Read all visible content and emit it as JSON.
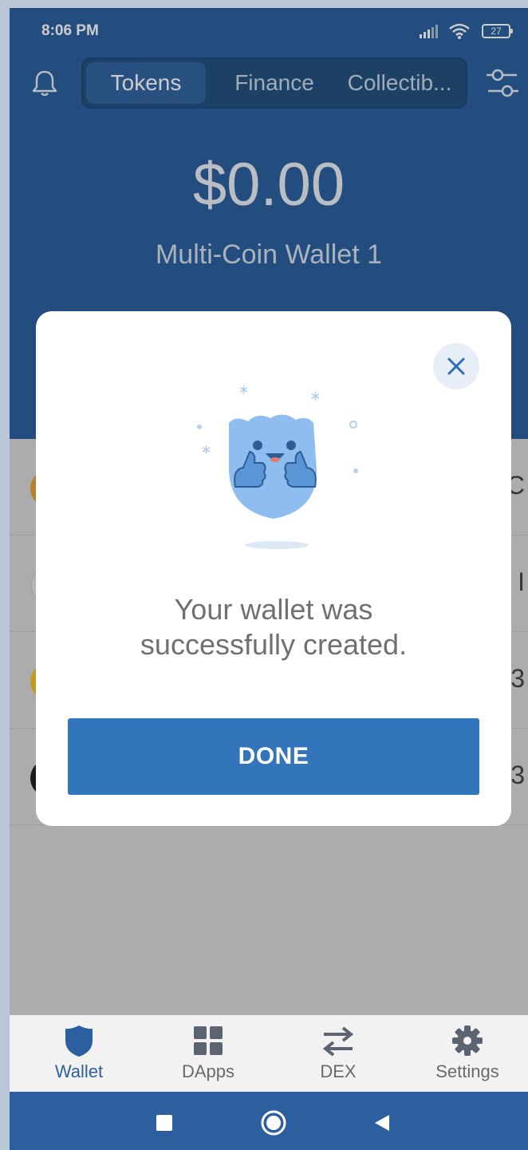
{
  "status_bar": {
    "time": "8:06 PM",
    "battery": "27"
  },
  "header": {
    "tabs": [
      {
        "label": "Tokens",
        "active": true
      },
      {
        "label": "Finance",
        "active": false
      },
      {
        "label": "Collectib..."
      }
    ]
  },
  "wallet": {
    "balance": "$0.00",
    "name": "Multi-Coin Wallet 1"
  },
  "list_rows": [
    {
      "coin_color": "#e6a23c",
      "trailing": "C"
    },
    {
      "coin_color": "#d9d9d9",
      "trailing": "I"
    },
    {
      "coin_color": "#f0c22c",
      "trailing": "3"
    },
    {
      "coin_color": "#222222",
      "trailing": "3"
    }
  ],
  "modal": {
    "message_line1": "Your wallet was",
    "message_line2": "successfully created.",
    "done_label": "DONE"
  },
  "bottom_nav": {
    "items": [
      {
        "label": "Wallet",
        "icon": "shield-icon",
        "active": true
      },
      {
        "label": "DApps",
        "icon": "grid-icon"
      },
      {
        "label": "DEX",
        "icon": "swap-arrows-icon"
      },
      {
        "label": "Settings",
        "icon": "gear-icon"
      }
    ]
  },
  "colors": {
    "brand": "#2c5f9f",
    "button": "#3375bb"
  }
}
